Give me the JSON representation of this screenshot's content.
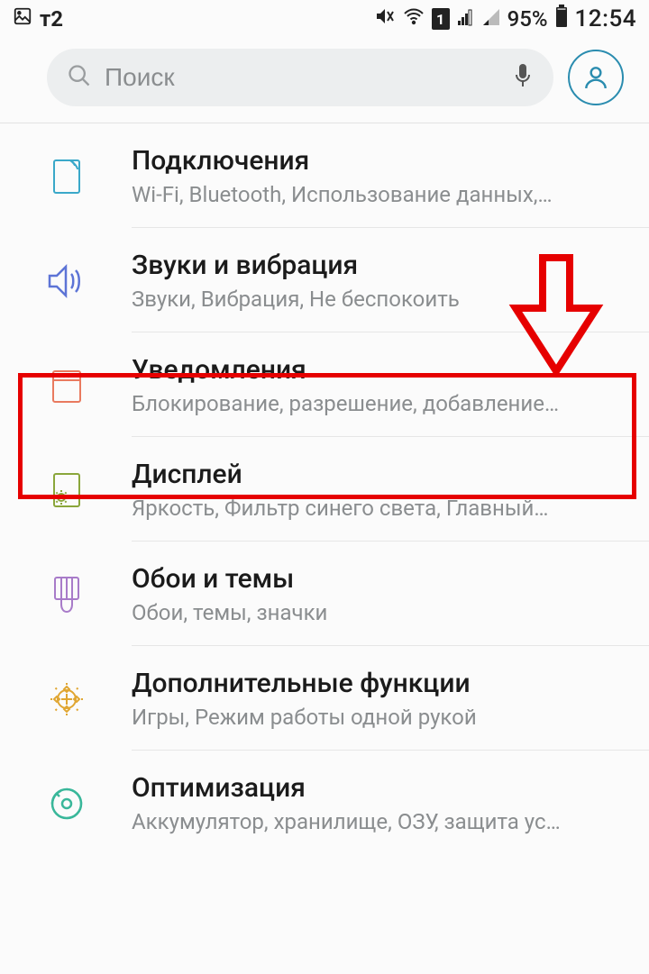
{
  "status": {
    "carrier": "т2",
    "battery_pct": "95%",
    "time": "12:54"
  },
  "search": {
    "placeholder": "Поиск"
  },
  "items": [
    {
      "title": "Подключения",
      "sub": "Wi-Fi, Bluetooth, Использование данных,…"
    },
    {
      "title": "Звуки и вибрация",
      "sub": "Звуки, Вибрация, Не беспокоить"
    },
    {
      "title": "Уведомления",
      "sub": "Блокирование, разрешение, добавление…"
    },
    {
      "title": "Дисплей",
      "sub": "Яркость, Фильтр синего света, Главный…"
    },
    {
      "title": "Обои и темы",
      "sub": "Обои, темы, значки"
    },
    {
      "title": "Дополнительные функции",
      "sub": "Игры, Режим работы одной рукой"
    },
    {
      "title": "Оптимизация",
      "sub": "Аккумулятор, хранилище, ОЗУ, защита ус…"
    }
  ],
  "annotations": {
    "highlighted_index": 2
  }
}
